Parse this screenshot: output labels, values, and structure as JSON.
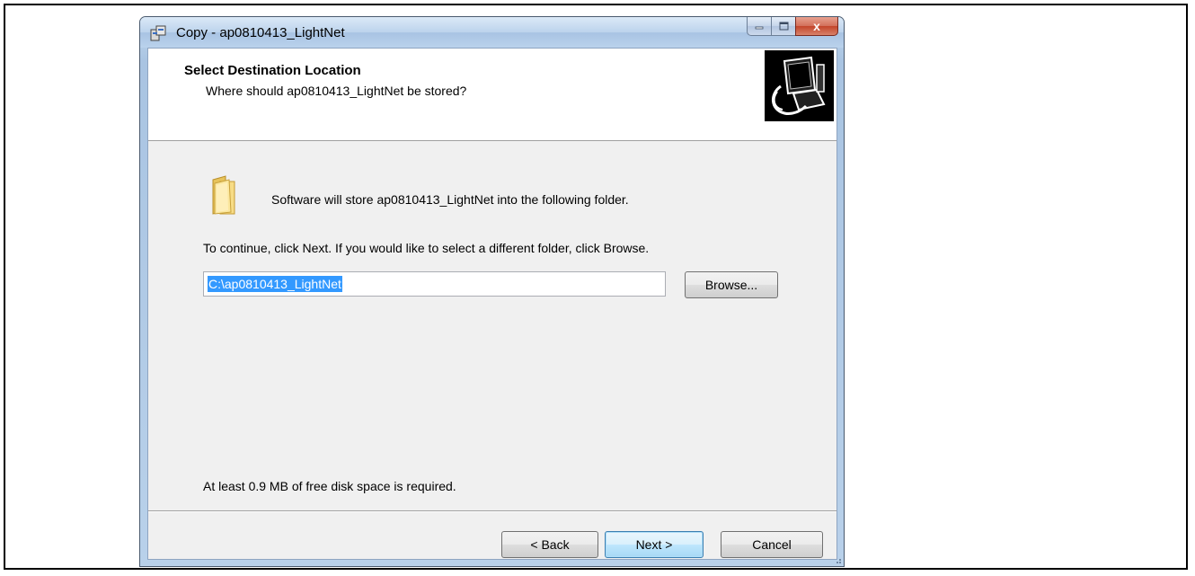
{
  "window": {
    "title": "Copy - ap0810413_LightNet",
    "caption_buttons": {
      "minimize_icon": "minimize-icon",
      "maximize_icon": "maximize-icon",
      "close_label": "x"
    }
  },
  "header": {
    "title": "Select Destination Location",
    "subtitle": "Where should ap0810413_LightNet be stored?",
    "image": "installer-computer-icon"
  },
  "body": {
    "info_text": "Software will store ap0810413_LightNet into the following folder.",
    "instruction_text": "To continue, click Next. If you would like to select a different folder, click Browse.",
    "path_value": "C:\\ap0810413_LightNet",
    "browse_label": "Browse...",
    "disk_space_text": "At least 0.9 MB of free disk space is required."
  },
  "footer": {
    "back_label": "< Back",
    "next_label": "Next >",
    "cancel_label": "Cancel"
  },
  "colors": {
    "selection": "#3399ff",
    "title_bar": "#bcd3ec",
    "close_button": "#c3452b",
    "default_button_border": "#3c7fb1"
  }
}
